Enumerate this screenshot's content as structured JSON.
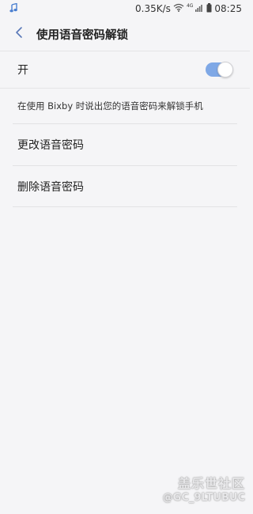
{
  "status_bar": {
    "net_speed": "0.35K/s",
    "network_type": "4G",
    "time": "08:25",
    "left_icon": "music-note-icon"
  },
  "header": {
    "title": "使用语音密码解锁",
    "back_icon": "back-arrow-icon"
  },
  "switch": {
    "label": "开",
    "state": "on",
    "accent_color": "#7fa8e6"
  },
  "description": "在使用 Bixby 时说出您的语音密码来解锁手机",
  "menu": {
    "items": [
      {
        "label": "更改语音密码"
      },
      {
        "label": "删除语音密码"
      }
    ]
  },
  "watermark": {
    "line1": "盖乐世社区",
    "line2": "@GC_9LTUBUC"
  }
}
